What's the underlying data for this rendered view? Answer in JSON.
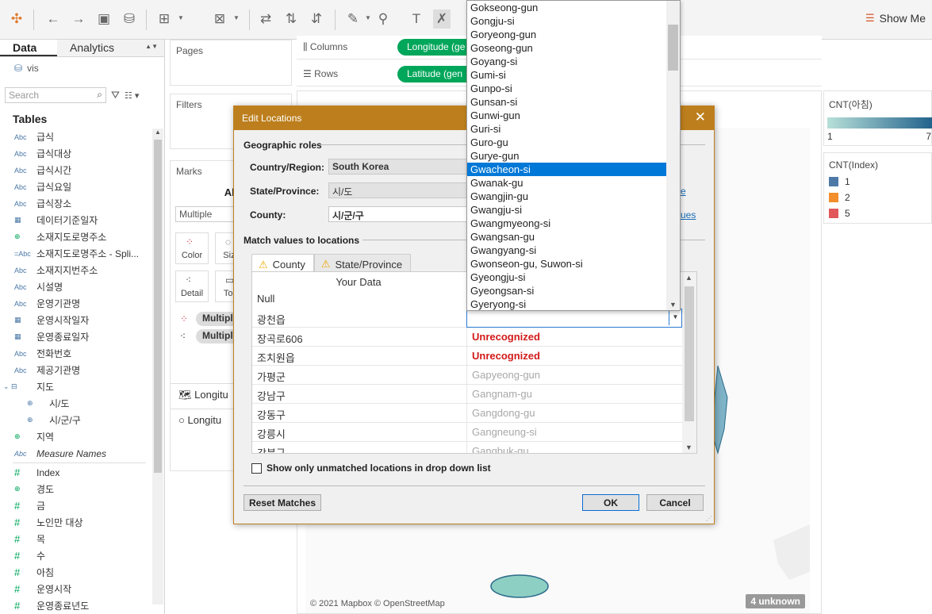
{
  "toolbar": {
    "show_me": "Show Me"
  },
  "left": {
    "tab_data": "Data",
    "tab_analytics": "Analytics",
    "datasource": "vis",
    "search_placeholder": "Search",
    "tables_header": "Tables",
    "fields": [
      {
        "type": "Abc",
        "name": "급식"
      },
      {
        "type": "Abc",
        "name": "급식대상"
      },
      {
        "type": "Abc",
        "name": "급식시간"
      },
      {
        "type": "Abc",
        "name": "급식요일"
      },
      {
        "type": "Abc",
        "name": "급식장소"
      },
      {
        "type": "date",
        "name": "데이터기준일자"
      },
      {
        "type": "geo",
        "name": "소재지도로명주소"
      },
      {
        "type": "=Abc",
        "name": "소재지도로명주소 - Spli..."
      },
      {
        "type": "Abc",
        "name": "소재지지번주소"
      },
      {
        "type": "Abc",
        "name": "시설명"
      },
      {
        "type": "Abc",
        "name": "운영기관명"
      },
      {
        "type": "date",
        "name": "운영시작일자"
      },
      {
        "type": "date",
        "name": "운영종료일자"
      },
      {
        "type": "Abc",
        "name": "전화번호"
      },
      {
        "type": "Abc",
        "name": "제공기관명"
      },
      {
        "type": "hier",
        "name": "지도"
      },
      {
        "type": "geo-sub",
        "name": "시/도"
      },
      {
        "type": "geo-sub",
        "name": "시/군/구"
      },
      {
        "type": "geo",
        "name": "지역"
      },
      {
        "type": "Abc",
        "name": "Measure Names",
        "italic": true
      }
    ],
    "measures": [
      {
        "type": "#",
        "name": "Index"
      },
      {
        "type": "geo",
        "name": "경도"
      },
      {
        "type": "#",
        "name": "금"
      },
      {
        "type": "#",
        "name": "노인만 대상"
      },
      {
        "type": "#",
        "name": "목"
      },
      {
        "type": "#",
        "name": "수"
      },
      {
        "type": "#",
        "name": "아침"
      },
      {
        "type": "#",
        "name": "운영시작"
      },
      {
        "type": "#",
        "name": "운영종료년도"
      }
    ]
  },
  "shelves": {
    "pages": "Pages",
    "filters": "Filters",
    "marks": "Marks",
    "marks_all": "All",
    "marks_type": "Multiple",
    "color": "Color",
    "size": "Size",
    "detail": "Detail",
    "tooltip": "Tool",
    "multiple_pill_1": "Multipl",
    "multiple_pill_2": "Multipl",
    "layer1": "Longitu",
    "layer2": "Longitu",
    "columns_label": "Columns",
    "rows_label": "Rows",
    "columns_pill": "Longitude (ge",
    "rows_pill": "Latitude (gen"
  },
  "view": {
    "attribution": "© 2021 Mapbox © OpenStreetMap",
    "unknown_badge": "4 unknown"
  },
  "legends": {
    "cnt_morning_title": "CNT(아침)",
    "cnt_morning_min": "1",
    "cnt_morning_max": "7",
    "cnt_index_title": "CNT(Index)",
    "items": [
      {
        "label": "1",
        "color": "#4e79a7"
      },
      {
        "label": "2",
        "color": "#f28e2b"
      },
      {
        "label": "5",
        "color": "#e15759"
      }
    ]
  },
  "dialog": {
    "title": "Edit Locations",
    "geographic_roles": "Geographic roles",
    "country_label": "Country/Region:",
    "country_value": "South Korea",
    "state_label": "State/Province:",
    "state_value": "시/도",
    "county_label": "County:",
    "county_value": "시/군/구",
    "link_state": "e",
    "link_county": "ues",
    "match_header": "Match values to locations",
    "tab_county": "County",
    "tab_state": "State/Province",
    "your_data": "Your Data",
    "rows": [
      {
        "data": "Null",
        "match": "",
        "status": "none"
      },
      {
        "data": "광천읍",
        "match": "",
        "status": "editing"
      },
      {
        "data": "장곡로606",
        "match": "Unrecognized",
        "status": "unrec"
      },
      {
        "data": "조치원읍",
        "match": "Unrecognized",
        "status": "unrec"
      },
      {
        "data": "가평군",
        "match": "Gapyeong-gun",
        "status": "matched"
      },
      {
        "data": "강남구",
        "match": "Gangnam-gu",
        "status": "matched"
      },
      {
        "data": "강동구",
        "match": "Gangdong-gu",
        "status": "matched"
      },
      {
        "data": "강릉시",
        "match": "Gangneung-si",
        "status": "matched"
      },
      {
        "data": "강북구",
        "match": "Gangbuk-gu",
        "status": "matched"
      }
    ],
    "show_unmatched": "Show only unmatched locations in drop down list",
    "reset": "Reset Matches",
    "ok": "OK",
    "cancel": "Cancel"
  },
  "dropdown": {
    "items": [
      "Gokseong-gun",
      "Gongju-si",
      "Goryeong-gun",
      "Goseong-gun",
      "Goyang-si",
      "Gumi-si",
      "Gunpo-si",
      "Gunsan-si",
      "Gunwi-gun",
      "Guri-si",
      "Guro-gu",
      "Gurye-gun",
      "Gwacheon-si",
      "Gwanak-gu",
      "Gwangjin-gu",
      "Gwangju-si",
      "Gwangmyeong-si",
      "Gwangsan-gu",
      "Gwangyang-si",
      "Gwonseon-gu, Suwon-si",
      "Gyeongju-si",
      "Gyeongsan-si",
      "Gyeryong-si"
    ],
    "selected": "Gwacheon-si"
  }
}
